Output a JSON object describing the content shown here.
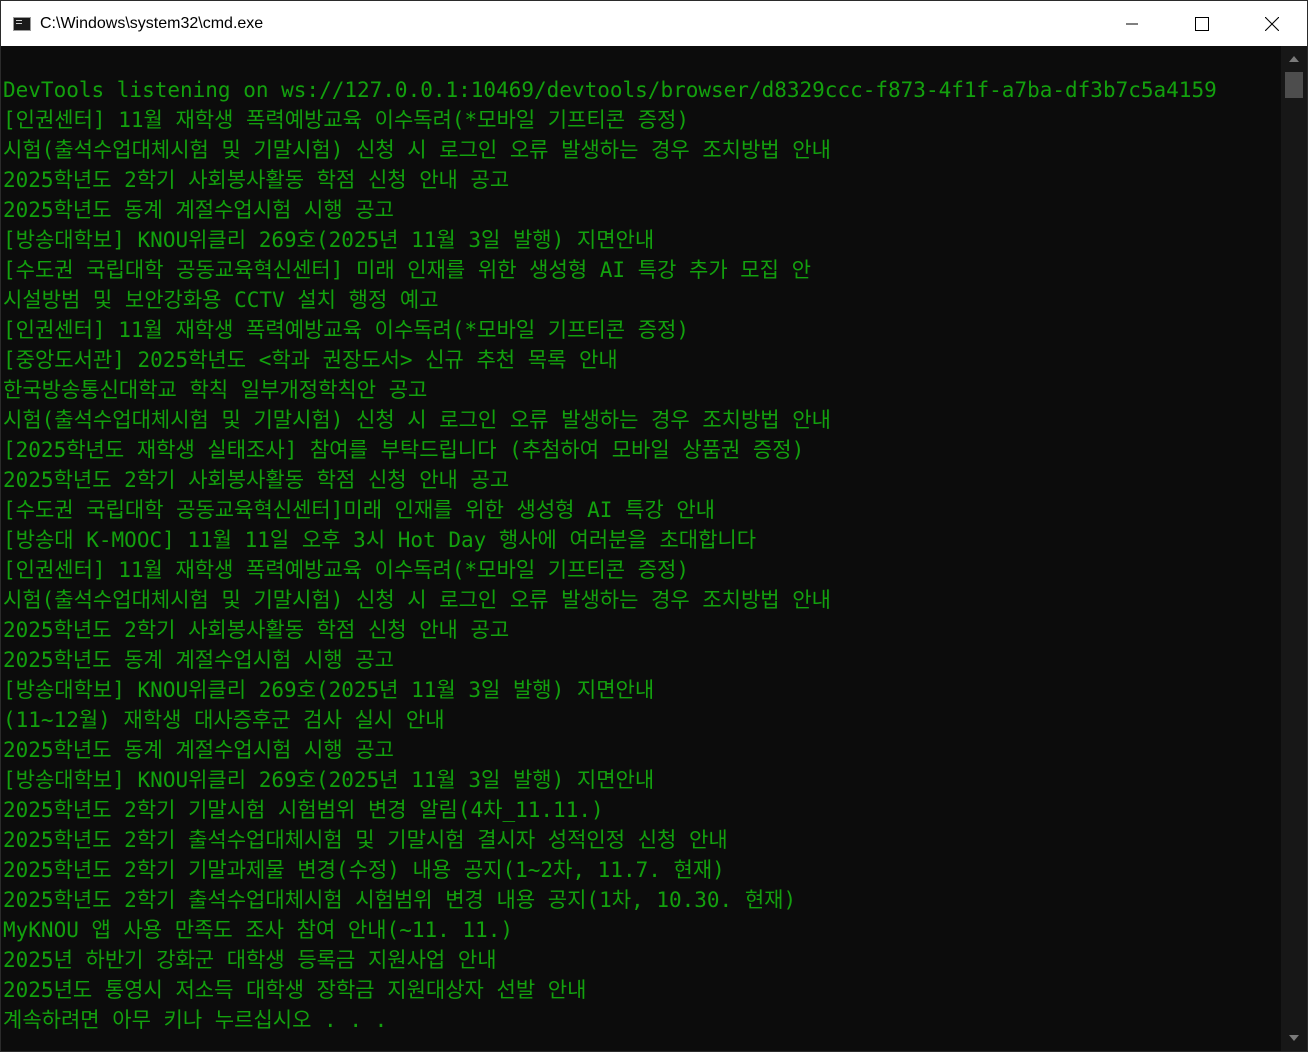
{
  "window": {
    "title": "C:\\Windows\\system32\\cmd.exe",
    "controls": {
      "minimize": "minimize-icon",
      "maximize": "maximize-icon",
      "close": "close-icon"
    }
  },
  "console": {
    "text_color": "#13a10e",
    "background_color": "#0c0c0c",
    "lines": [
      "DevTools listening on ws://127.0.0.1:10469/devtools/browser/d8329ccc-f873-4f1f-a7ba-df3b7c5a4159",
      "[인권센터] 11월 재학생 폭력예방교육 이수독려(*모바일 기프티콘 증정)",
      "시험(출석수업대체시험 및 기말시험) 신청 시 로그인 오류 발생하는 경우 조치방법 안내",
      "2025학년도 2학기 사회봉사활동 학점 신청 안내 공고",
      "2025학년도 동계 계절수업시험 시행 공고",
      "[방송대학보] KNOU위클리 269호(2025년 11월 3일 발행) 지면안내",
      "[수도권 국립대학 공동교육혁신센터] 미래 인재를 위한 생성형 AI 특강 추가 모집 안",
      "시설방범 및 보안강화용 CCTV 설치 행정 예고",
      "[인권센터] 11월 재학생 폭력예방교육 이수독려(*모바일 기프티콘 증정)",
      "[중앙도서관] 2025학년도 <학과 권장도서> 신규 추천 목록 안내",
      "한국방송통신대학교 학칙 일부개정학칙안 공고",
      "시험(출석수업대체시험 및 기말시험) 신청 시 로그인 오류 발생하는 경우 조치방법 안내",
      "[2025학년도 재학생 실태조사] 참여를 부탁드립니다 (추첨하여 모바일 상품권 증정)",
      "2025학년도 2학기 사회봉사활동 학점 신청 안내 공고",
      "[수도권 국립대학 공동교육혁신센터]미래 인재를 위한 생성형 AI 특강 안내",
      "[방송대 K-MOOC] 11월 11일 오후 3시 Hot Day 행사에 여러분을 초대합니다",
      "[인권센터] 11월 재학생 폭력예방교육 이수독려(*모바일 기프티콘 증정)",
      "시험(출석수업대체시험 및 기말시험) 신청 시 로그인 오류 발생하는 경우 조치방법 안내",
      "2025학년도 2학기 사회봉사활동 학점 신청 안내 공고",
      "2025학년도 동계 계절수업시험 시행 공고",
      "[방송대학보] KNOU위클리 269호(2025년 11월 3일 발행) 지면안내",
      "(11~12월) 재학생 대사증후군 검사 실시 안내",
      "2025학년도 동계 계절수업시험 시행 공고",
      "[방송대학보] KNOU위클리 269호(2025년 11월 3일 발행) 지면안내",
      "2025학년도 2학기 기말시험 시험범위 변경 알림(4차_11.11.)",
      "2025학년도 2학기 출석수업대체시험 및 기말시험 결시자 성적인정 신청 안내",
      "2025학년도 2학기 기말과제물 변경(수정) 내용 공지(1~2차, 11.7. 현재)",
      "2025학년도 2학기 출석수업대체시험 시험범위 변경 내용 공지(1차, 10.30. 현재)",
      "MyKNOU 앱 사용 만족도 조사 참여 안내(~11. 11.)",
      "2025년 하반기 강화군 대학생 등록금 지원사업 안내",
      "2025년도 통영시 저소득 대학생 장학금 지원대상자 선발 안내",
      "계속하려면 아무 키나 누르십시오 . . ."
    ]
  }
}
